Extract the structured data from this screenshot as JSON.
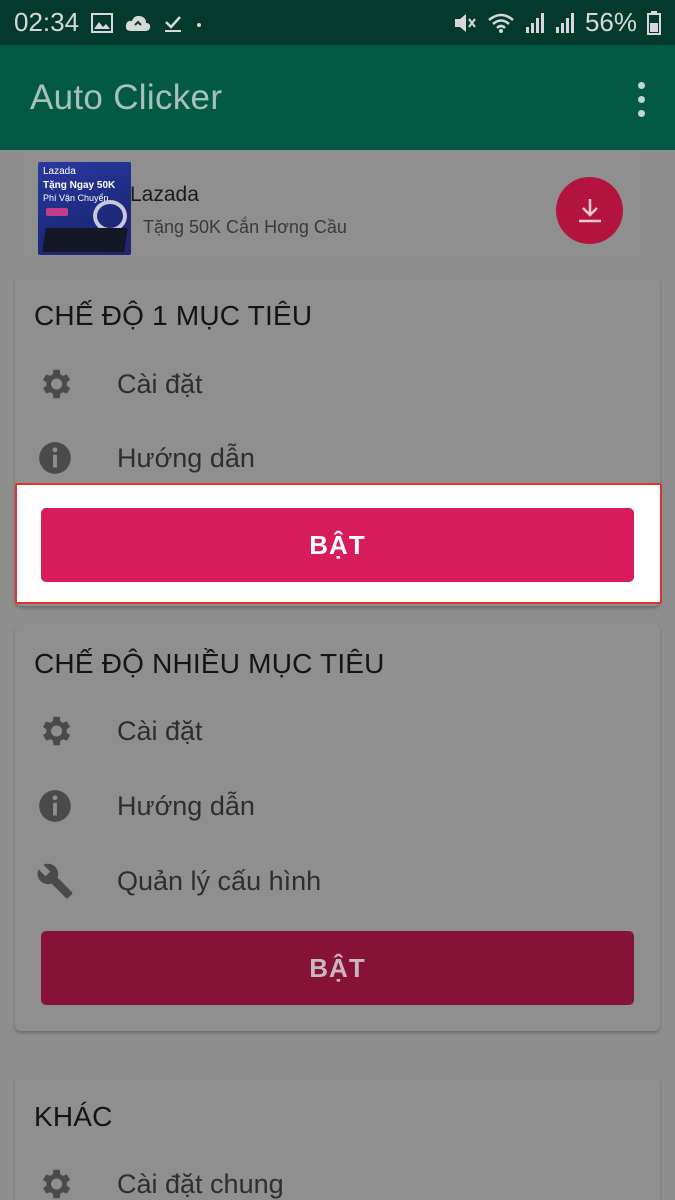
{
  "status_bar": {
    "time": "02:34",
    "battery": "56%"
  },
  "app_bar": {
    "title": "Auto Clicker",
    "menu_icon": "more-vert-icon"
  },
  "ad": {
    "brand": "Lazada",
    "subtitle": "Tặng 50K Cắn Hơng Cầu",
    "thumb_text_line1": "Tặng Ngay 50K",
    "thumb_text_line2": "Phí Vận Chuyển",
    "thumb_logo": "Lazada",
    "download_icon": "download-icon"
  },
  "single_mode": {
    "title": "CHẾ ĐỘ 1 MỤC TIÊU",
    "settings_label": "Cài đặt",
    "guide_label": "Hướng dẫn",
    "button_label": "BẬT"
  },
  "multi_mode": {
    "title": "CHẾ ĐỘ NHIỀU MỤC TIÊU",
    "settings_label": "Cài đặt",
    "guide_label": "Hướng dẫn",
    "config_label": "Quản lý cấu hình",
    "button_label": "BẬT"
  },
  "other": {
    "title": "KHÁC",
    "general_settings_label": "Cài đặt chung"
  },
  "colors": {
    "status_bar": "#043a2c",
    "app_bar": "#035a44",
    "accent": "#d81b5a",
    "highlight_border": "#e0332d"
  }
}
